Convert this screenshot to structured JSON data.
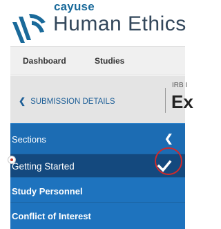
{
  "brand": {
    "company": "cayuse",
    "product": "Human Ethics"
  },
  "nav": {
    "items": [
      "Dashboard",
      "Studies"
    ]
  },
  "submission": {
    "back_label": "SUBMISSION DETAILS",
    "irb_label": "IRB I",
    "title_fragment": "Ex"
  },
  "sidebar": {
    "header": "Sections",
    "items": [
      {
        "label": "Getting Started",
        "state": "active",
        "complete": true,
        "required_marker": true
      },
      {
        "label": "Study Personnel",
        "state": "default"
      },
      {
        "label": "Conflict of Interest",
        "state": "default"
      }
    ]
  },
  "colors": {
    "accent": "#1e73be",
    "active_item": "#14497e",
    "brand_text": "#33475b",
    "highlight": "#d12a2a"
  },
  "icons": [
    "cayuse-logo-icon",
    "chevron-left-icon",
    "collapse-chevron-icon",
    "required-indicator-icon",
    "checkmark-icon"
  ]
}
